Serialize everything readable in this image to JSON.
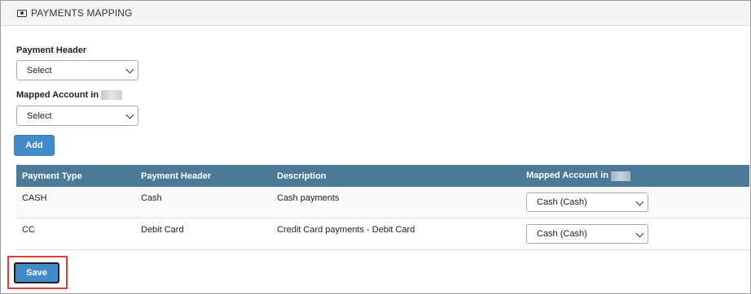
{
  "panel": {
    "title": "PAYMENTS MAPPING",
    "icon": "money-icon"
  },
  "form": {
    "payment_header_label": "Payment Header",
    "payment_header_value": "Select",
    "mapped_account_label": "Mapped Account in",
    "mapped_account_value": "Select",
    "add_label": "Add"
  },
  "table": {
    "headers": [
      "Payment Type",
      "Payment Header",
      "Description",
      "Mapped Account in"
    ],
    "rows": [
      {
        "type": "CASH",
        "header": "Cash",
        "description": "Cash payments",
        "mapped": "Cash (Cash)"
      },
      {
        "type": "CC",
        "header": "Debit Card",
        "description": "Credit Card payments - Debit Card",
        "mapped": "Cash (Cash)"
      }
    ]
  },
  "save_label": "Save",
  "colors": {
    "header_bg": "#4a7a98",
    "button": "#428bca",
    "highlight": "#e23b3b"
  }
}
